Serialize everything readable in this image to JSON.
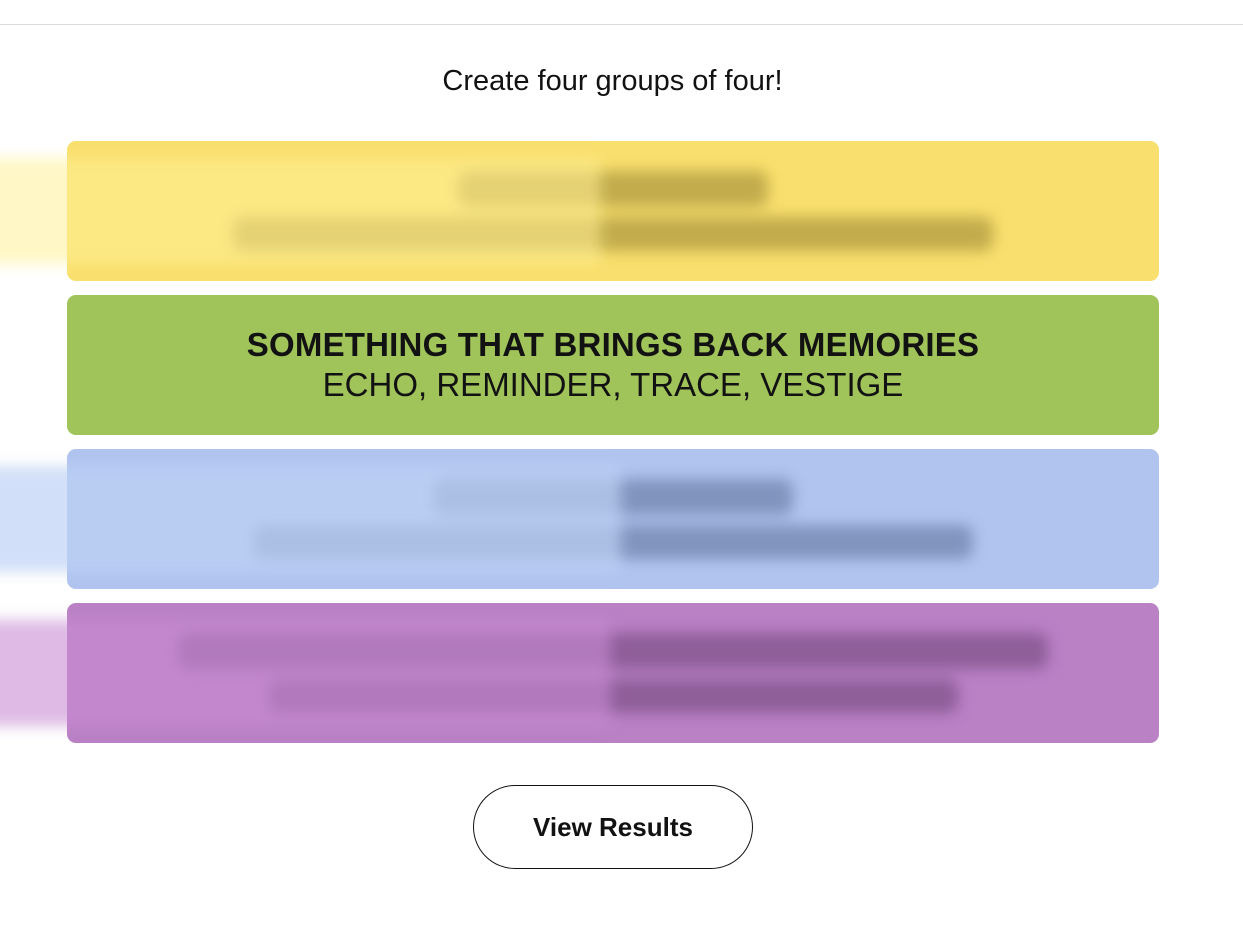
{
  "header": {
    "subtitle": "Create four groups of four!"
  },
  "groups": [
    {
      "color": "#f9df6d",
      "revealed": false
    },
    {
      "color": "#a0c35a",
      "revealed": true,
      "title": "SOMETHING THAT BRINGS BACK MEMORIES",
      "words": "ECHO, REMINDER, TRACE, VESTIGE"
    },
    {
      "color": "#b0c4ef",
      "revealed": false
    },
    {
      "color": "#ba81c5",
      "revealed": false
    }
  ],
  "actions": {
    "view_results_label": "View Results"
  }
}
